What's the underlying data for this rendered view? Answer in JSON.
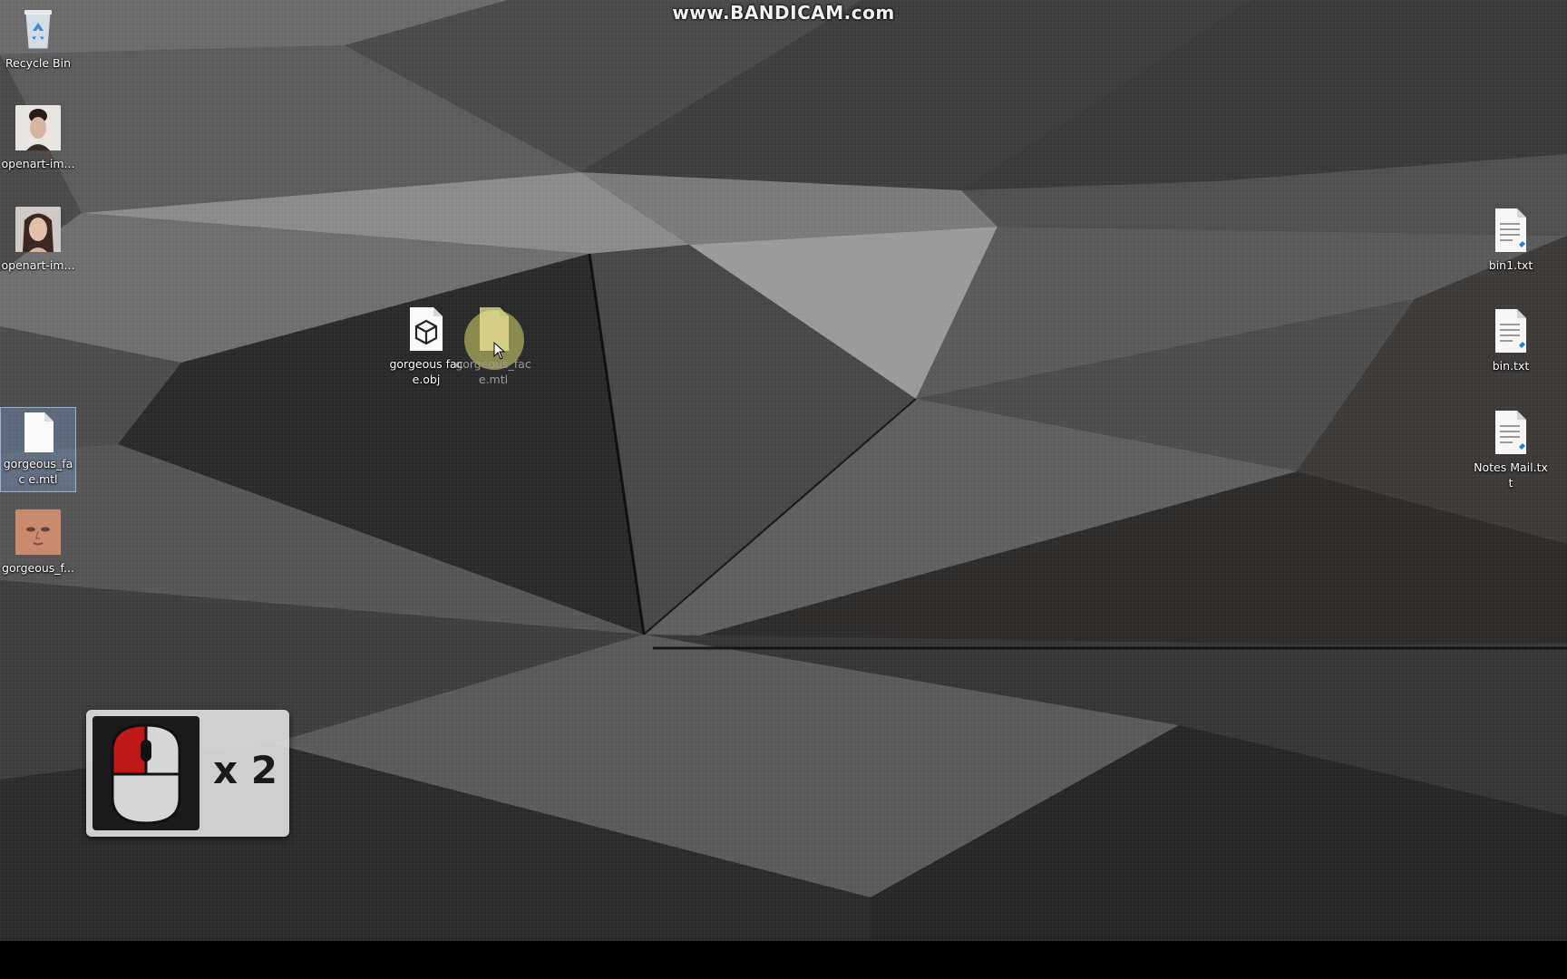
{
  "watermark": "www.BANDICAM.com",
  "colors": {
    "selection": "#78a0d2",
    "click_highlight": "#dcd76e",
    "mouse_button_active": "#c01818"
  },
  "desktop_icons": [
    {
      "id": "recycle-bin",
      "label": "Recycle Bin",
      "icon": "recycle-bin-icon"
    },
    {
      "id": "openart-image-1",
      "label": "openart-im...",
      "icon": "portrait-thumbnail-icon"
    },
    {
      "id": "openart-image-2",
      "label": "openart-im...",
      "icon": "portrait-thumbnail-icon"
    },
    {
      "id": "gorgeous-face-mtl-selected",
      "label": "gorgeous_fac e.mtl",
      "icon": "blank-file-icon",
      "selected": true
    },
    {
      "id": "gorgeous-face-texture",
      "label": "gorgeous_f...",
      "icon": "face-texture-thumbnail-icon"
    },
    {
      "id": "gorgeous-face-obj",
      "label": "gorgeous face.obj",
      "icon": "3d-object-file-icon"
    },
    {
      "id": "gorgeous-face-mtl-dragged",
      "label": "gorgeous_fac e.mtl",
      "icon": "blank-file-icon",
      "state": "being-dragged"
    },
    {
      "id": "bin1-txt",
      "label": "bin1.txt",
      "icon": "text-document-icon"
    },
    {
      "id": "bin-txt",
      "label": "bin.txt",
      "icon": "text-document-icon"
    },
    {
      "id": "notes-mail-txt",
      "label": "Notes Mail.txt",
      "icon": "text-document-icon"
    }
  ],
  "mouse_overlay": {
    "button": "left",
    "click_count": "x 2"
  }
}
